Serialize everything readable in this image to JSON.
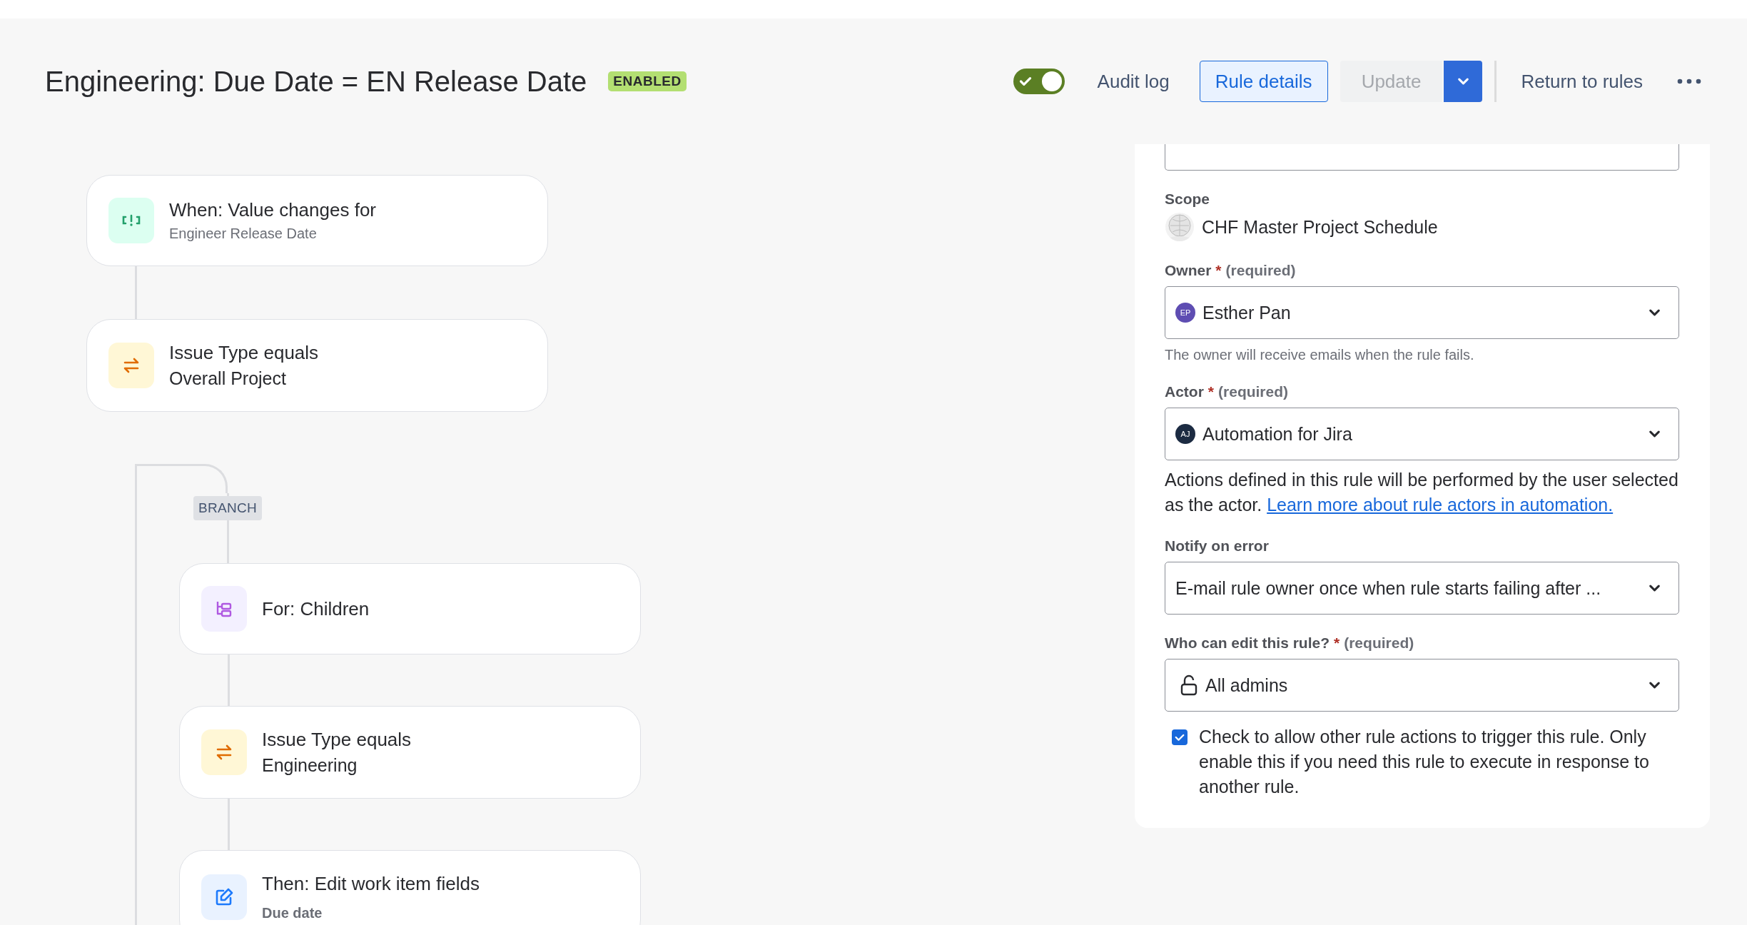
{
  "header": {
    "title": "Engineering: Due Date = EN Release Date",
    "status_badge": "ENABLED",
    "rule_enabled": true,
    "actions": {
      "audit_log": "Audit log",
      "rule_details": {
        "label": "Rule details",
        "selected": true
      },
      "update": {
        "label": "Update",
        "disabled": true
      },
      "return_to_rules": "Return to rules"
    }
  },
  "flow": {
    "steps": [
      {
        "kind": "trigger",
        "title": "When: Value changes for",
        "subtitle": "Engineer Release Date"
      },
      {
        "kind": "condition",
        "title": "Issue Type equals",
        "subtitle": "Overall Project"
      }
    ],
    "branch": {
      "label": "BRANCH",
      "steps": [
        {
          "kind": "for",
          "title": "For: Children"
        },
        {
          "kind": "condition",
          "title": "Issue Type equals",
          "subtitle": "Engineering"
        },
        {
          "kind": "action",
          "title": "Then: Edit work item fields",
          "subtitle": "Due date"
        }
      ]
    }
  },
  "panel": {
    "scope": {
      "label": "Scope",
      "value": "CHF Master Project Schedule"
    },
    "fields": [
      {
        "kind": "user",
        "label": "Owner",
        "required_mark": "*",
        "required_note": "(required)",
        "value": "Esther Pan",
        "avatar": "EP",
        "color": "#5e4db2",
        "help": "The owner will receive emails when the rule fails."
      },
      {
        "kind": "user",
        "label": "Actor",
        "required_mark": "*",
        "required_note": "(required)",
        "value": "Automation for Jira",
        "avatar": "AJ",
        "color": "#1c2b42",
        "note": "Actions defined in this rule will be performed by the user selected as the actor.",
        "link": "Learn more about rule actors in automation."
      },
      {
        "kind": "plain",
        "label": "Notify on error",
        "value": "E-mail rule owner once when rule starts failing after ..."
      },
      {
        "kind": "lock",
        "label": "Who can edit this rule?",
        "required_mark": "*",
        "required_note": "(required)",
        "value": "All admins"
      }
    ],
    "checkbox": {
      "checked": true,
      "label": "Check to allow other rule actions to trigger this rule. Only enable this if you need this rule to execute in response to another rule."
    }
  }
}
